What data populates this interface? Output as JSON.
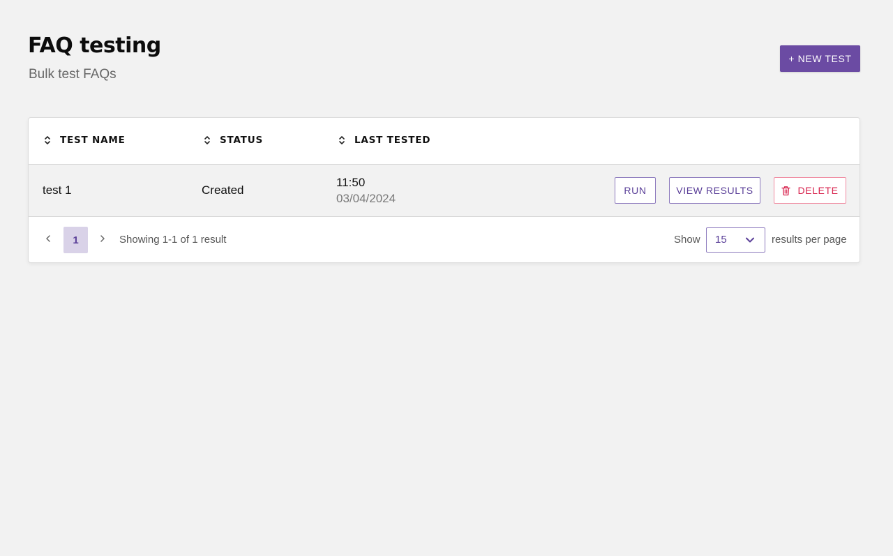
{
  "header": {
    "title": "FAQ testing",
    "subtitle": "Bulk test FAQs",
    "new_test_label": "+ NEW TEST"
  },
  "table": {
    "columns": [
      {
        "label": "TEST NAME",
        "sort_icon": "sort-icon"
      },
      {
        "label": "STATUS",
        "sort_icon": "sort-icon"
      },
      {
        "label": "LAST TESTED",
        "sort_icon": "sort-icon"
      }
    ],
    "rows": [
      {
        "name": "test 1",
        "status": "Created",
        "last_tested_time": "11:50",
        "last_tested_date": "03/04/2024",
        "actions": {
          "run": "RUN",
          "view_results": "VIEW RESULTS",
          "delete": "DELETE"
        }
      }
    ]
  },
  "pagination": {
    "current_page": "1",
    "showing_text": "Showing 1-1 of 1 result",
    "show_label": "Show",
    "per_page_value": "15",
    "per_page_suffix": "results per page"
  },
  "colors": {
    "accent": "#6b4ba3",
    "accent_text": "#5a3f98",
    "danger": "#d8254f",
    "background": "#f2f2f2"
  }
}
